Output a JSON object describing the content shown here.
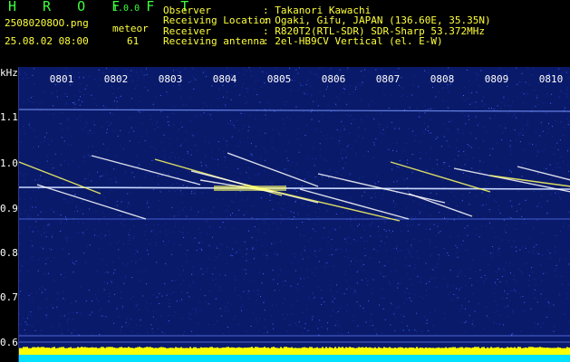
{
  "header": {
    "app_title": "H R O F F T",
    "version": "1.0.0",
    "filename": "25080208OO.png",
    "meteor_label": "meteor",
    "datetime": "25.08.02 08:00",
    "meteor_count": "61",
    "observer_label": "Observer",
    "observer_value": ": Takanori Kawachi",
    "location_label": "Receiving Location",
    "location_value": ": Ogaki, Gifu, JAPAN (136.60E, 35.35N)",
    "receiver_label": "Receiver",
    "receiver_value": ": R820T2(RTL-SDR) SDR-Sharp 53.372MHz",
    "antenna_label": "Receiving antenna",
    "antenna_value": ": 2el-HB9CV Vertical (el. E-W)"
  },
  "spectrogram": {
    "y_unit": "kHz",
    "y_ticks": [
      "1.1",
      "1.0",
      "0.9",
      "0.8",
      "0.7",
      "0.6"
    ],
    "time_ticks": [
      "0801",
      "0802",
      "0803",
      "0804",
      "0805",
      "0806",
      "0807",
      "0808",
      "0809",
      "0810"
    ]
  },
  "colors": {
    "background": "#0a1a6a",
    "noise_low": "#1430a0",
    "noise_high": "#3c64ff",
    "trail": "#ffffff",
    "trail_hot": "#ffff64",
    "baseline_yellow": "#ffff00",
    "baseline_cyan": "#00e0ff"
  }
}
